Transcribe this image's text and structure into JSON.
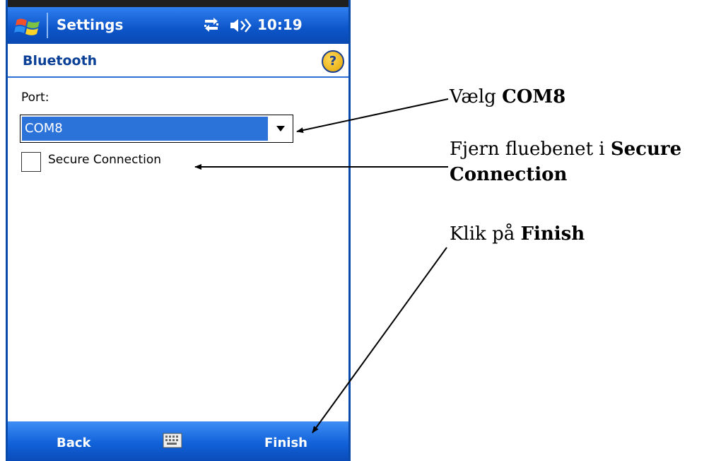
{
  "titlebar": {
    "title": "Settings",
    "time": "10:19",
    "icons": [
      "windows-start-icon",
      "connectivity-icon",
      "volume-icon"
    ]
  },
  "page": {
    "title": "Bluetooth",
    "help_icon": "?"
  },
  "form": {
    "port_label": "Port:",
    "port_value": "COM8",
    "secure_label": "Secure Connection",
    "secure_checked": false
  },
  "menubar": {
    "left": "Back",
    "right": "Finish",
    "keyboard_icon": "keyboard-icon"
  },
  "annotations": {
    "a1_pre": "Vælg ",
    "a1_bold": "COM8",
    "a2_pre": "Fjern fluebenet i ",
    "a2_bold1": "Secure",
    "a2_bold2": "Connection",
    "a3_pre": "Klik på ",
    "a3_bold": "Finish"
  },
  "colors": {
    "titlebar": "#0c55c8",
    "selection": "#2b73d9",
    "header_text": "#0a3f97"
  }
}
